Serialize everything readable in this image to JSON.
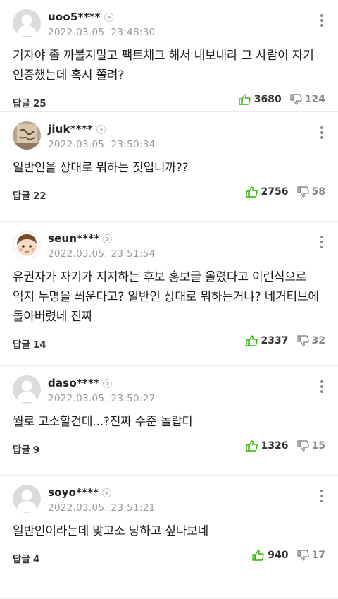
{
  "colors": {
    "like_icon": "#2db400",
    "dislike_icon": "#8c8c8c",
    "meta_text": "#9a9a9a"
  },
  "comments": [
    {
      "avatar": "default-person",
      "nickname": "uoo5****",
      "datetime": "2022.03.05. 23:48:30",
      "text": "기자야 좀 까불지말고 팩트체크 해서 내보내라 그 사람이 자기 인증했는데 혹시 쫄려?",
      "reply_label": "답글",
      "reply_count": "25",
      "likes": "3680",
      "dislikes": "124"
    },
    {
      "avatar": "photo",
      "nickname": "jiuk****",
      "datetime": "2022.03.05. 23:50:34",
      "text": "일반인을 상대로 뭐하는 짓입니까??",
      "reply_label": "답글",
      "reply_count": "22",
      "likes": "2756",
      "dislikes": "58"
    },
    {
      "avatar": "cartoon-face",
      "nickname": "seun****",
      "datetime": "2022.03.05. 23:51:54",
      "text": "유권자가 자기가 지지하는 후보 홍보글 올렸다고 이런식으로 억지 누명을 씌운다고? 일반인 상대로 뭐하는거냐? 네거티브에 돌아버렸네 진짜",
      "reply_label": "답글",
      "reply_count": "14",
      "likes": "2337",
      "dislikes": "32"
    },
    {
      "avatar": "default-person",
      "nickname": "daso****",
      "datetime": "2022.03.05. 23:50:27",
      "text": "뭘로 고소할건데...?진짜 수준 놀랍다",
      "reply_label": "답글",
      "reply_count": "9",
      "likes": "1326",
      "dislikes": "15"
    },
    {
      "avatar": "default-person",
      "nickname": "soyo****",
      "datetime": "2022.03.05. 23:51:21",
      "text": "일반인이라는데 맞고소 당하고 싶나보네",
      "reply_label": "답글",
      "reply_count": "4",
      "likes": "940",
      "dislikes": "17"
    }
  ]
}
